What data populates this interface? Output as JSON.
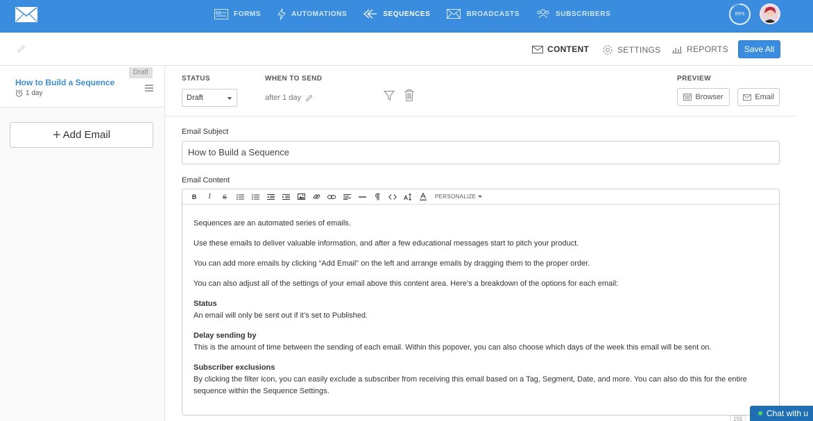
{
  "colors": {
    "brand": "#3a8dde",
    "link": "#3a8dde",
    "chat": "#1f6fb5",
    "online": "#4cd964"
  },
  "nav": {
    "items": [
      {
        "label": "FORMS",
        "icon": "form-icon"
      },
      {
        "label": "AUTOMATIONS",
        "icon": "lightning-icon"
      },
      {
        "label": "SEQUENCES",
        "icon": "sequence-icon",
        "active": true
      },
      {
        "label": "BROADCASTS",
        "icon": "envelope-icon"
      },
      {
        "label": "SUBSCRIBERS",
        "icon": "users-icon"
      }
    ],
    "progress": "89%",
    "progress_value": 0.89
  },
  "subbar": {
    "tabs": [
      {
        "label": "CONTENT",
        "icon": "envelope-icon",
        "active": true
      },
      {
        "label": "SETTINGS",
        "icon": "gear-icon"
      },
      {
        "label": "REPORTS",
        "icon": "bar-chart-icon"
      }
    ],
    "save_label": "Save All"
  },
  "sidebar": {
    "sequence_email": {
      "title": "How to Build a Sequence",
      "delay": "1 day",
      "badge": "Draft"
    },
    "add_email_label": "Add Email"
  },
  "settings": {
    "status_label": "STATUS",
    "status_value": "Draft",
    "when_label": "WHEN TO SEND",
    "when_value": "after 1 day",
    "preview_label": "PREVIEW",
    "preview_browser": "Browser",
    "preview_email": "Email"
  },
  "editor": {
    "subject_label": "Email Subject",
    "subject_value": "How to Build a Sequence",
    "content_label": "Email Content",
    "toolbar": [
      "B",
      "I",
      "S"
    ],
    "personalize_label": "PERSONALIZE",
    "paragraphs": [
      "Sequences are an automated series of emails.",
      "Use these emails to deliver valuable information, and after a few educational messages start to pitch your product.",
      "You can add more emails by clicking “Add Email” on the left and arrange emails by dragging them to the proper order.",
      "You can also adjust all of the settings of your email above this content area. Here’s a breakdown of the options for each email:"
    ],
    "sections": [
      {
        "heading": "Status",
        "text": "An email will only be sent out if it’s set to Published."
      },
      {
        "heading": "Delay sending by",
        "text": "This is the amount of time between the sending of each email. Within this popover, you can also choose which days of the week this email will be sent on."
      },
      {
        "heading": "Subscriber exclusions",
        "text": "By clicking the filter icon, you can easily exclude a subscriber from receiving this email based on a Tag, Segment, Date, and more. You can also do this for the entire sequence within the Sequence Settings."
      }
    ]
  },
  "chat": {
    "label": "Chat with u"
  },
  "counter": "155"
}
